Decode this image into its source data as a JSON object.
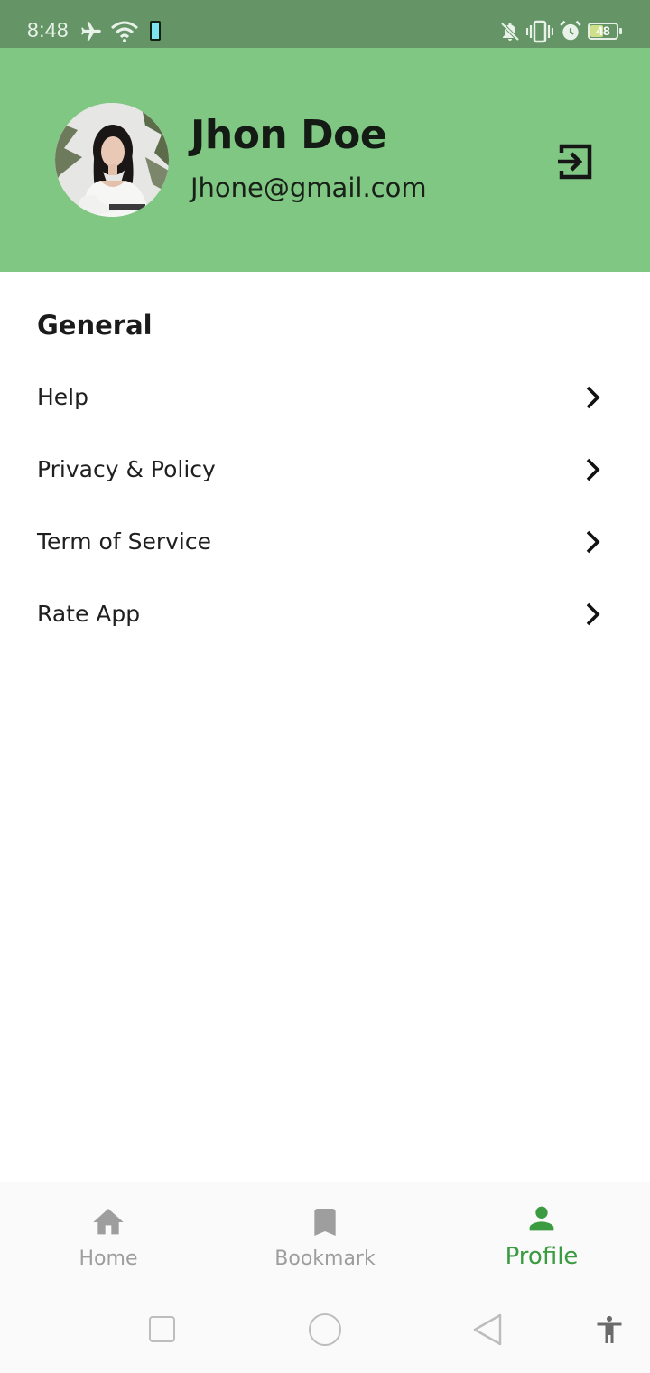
{
  "status_bar": {
    "time": "8:48",
    "battery": "48",
    "icons": [
      "airplane-icon",
      "wifi-icon",
      "phone-device-icon",
      "notifications-off-icon",
      "vibrate-icon",
      "alarm-icon",
      "battery-icon"
    ]
  },
  "profile": {
    "name": "Jhon Doe",
    "email": "Jhone@gmail.com",
    "avatar_icon": "avatar",
    "logout_icon": "logout-icon"
  },
  "general": {
    "title": "General",
    "items": [
      {
        "label": "Help",
        "icon": "chevron-right-icon"
      },
      {
        "label": "Privacy & Policy",
        "icon": "chevron-right-icon"
      },
      {
        "label": "Term of Service",
        "icon": "chevron-right-icon"
      },
      {
        "label": "Rate App",
        "icon": "chevron-right-icon"
      }
    ]
  },
  "bottom_nav": {
    "items": [
      {
        "label": "Home",
        "icon": "home-icon",
        "active": false
      },
      {
        "label": "Bookmark",
        "icon": "bookmark-icon",
        "active": false
      },
      {
        "label": "Profile",
        "icon": "person-icon",
        "active": true
      }
    ]
  },
  "colors": {
    "status_bar": "#659566",
    "header": "#80c783",
    "active_tab": "#3b9b41",
    "inactive_tab": "#9e9e9e"
  }
}
